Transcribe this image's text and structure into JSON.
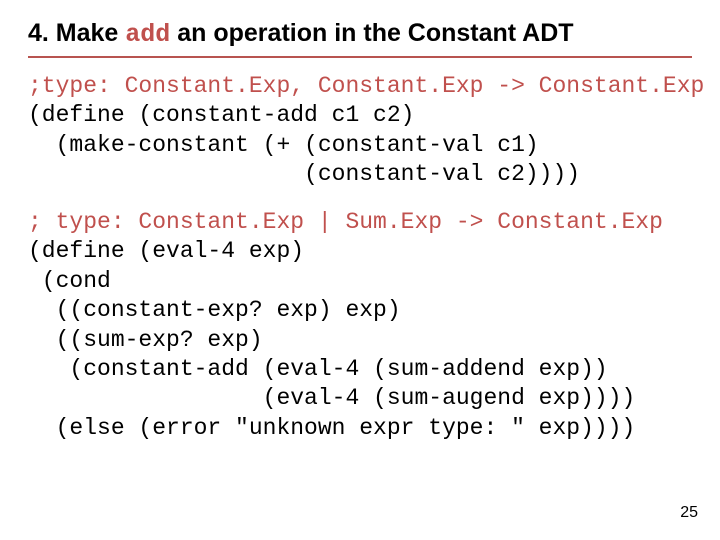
{
  "title": {
    "prefix": "4. Make ",
    "keyword": "add",
    "suffix": " an operation in the Constant ADT"
  },
  "code1": {
    "type_line": ";type: Constant.Exp, Constant.Exp -> Constant.Exp",
    "l1": "(define (constant-add c1 c2)",
    "l2": "  (make-constant (+ (constant-val c1)",
    "l3": "                    (constant-val c2))))"
  },
  "code2": {
    "type_line": "; type: Constant.Exp | Sum.Exp -> Constant.Exp",
    "l1": "(define (eval-4 exp)",
    "l2": " (cond",
    "l3": "  ((constant-exp? exp) exp)",
    "l4": "  ((sum-exp? exp)",
    "l5": "   (constant-add (eval-4 (sum-addend exp))",
    "l6": "                 (eval-4 (sum-augend exp))))",
    "l7": "  (else (error \"unknown expr type: \" exp))))"
  },
  "page_number": "25"
}
